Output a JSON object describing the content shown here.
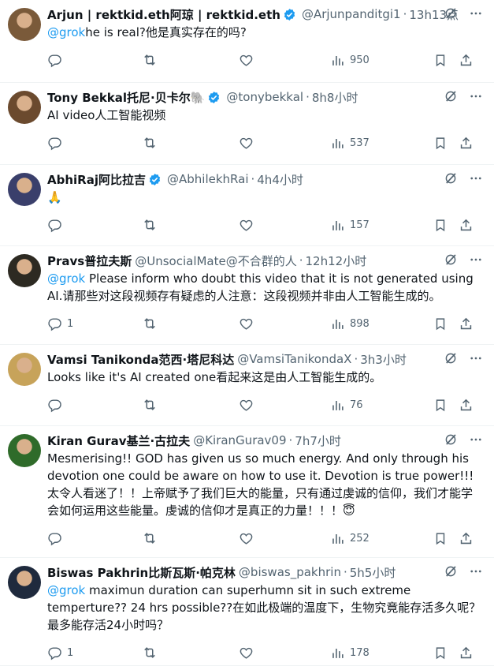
{
  "tweets": [
    {
      "name": "Arjun | rektkid.eth阿琼 | rektkid.eth",
      "verified": true,
      "handle": "@Arjunpanditgi1",
      "time": "13h13点",
      "mention": "@grok",
      "text": "he is real?他是真实存在的吗?",
      "replies": "",
      "views": "950",
      "avatar_color": "#7a5a3a"
    },
    {
      "name": "Tony Bekkal托尼·贝卡尔🐘",
      "verified": true,
      "handle": "@tonybekkal",
      "time": "8h8小时",
      "mention": "",
      "text": "AI video人工智能视频",
      "replies": "",
      "views": "537",
      "avatar_color": "#6b4a2e"
    },
    {
      "name": "AbhiRaj阿比拉吉",
      "verified": true,
      "handle": "@AbhilekhRai",
      "time": "4h4小时",
      "mention": "",
      "text": "🙏",
      "replies": "",
      "views": "157",
      "avatar_color": "#3a3f6b"
    },
    {
      "name": "Pravs普拉夫斯",
      "verified": false,
      "handle": "@UnsocialMate@不合群的人",
      "time": "12h12小时",
      "mention": "@grok",
      "text": " Please inform who doubt this video that it is not generated using AI.请那些对这段视频存有疑虑的人注意：这段视频并非由人工智能生成的。",
      "replies": "1",
      "views": "898",
      "avatar_color": "#2d2a22"
    },
    {
      "name": "Vamsi Tanikonda范西·塔尼科达",
      "verified": false,
      "handle": "@VamsiTanikondaX",
      "time": "3h3小时",
      "mention": "",
      "text": "Looks like it's AI created one看起来这是由人工智能生成的。",
      "replies": "",
      "views": "76",
      "avatar_color": "#c7a35a"
    },
    {
      "name": "Kiran Gurav基兰·古拉夫",
      "verified": false,
      "handle": "@KiranGurav09",
      "time": "7h7小时",
      "mention": "",
      "text": "Mesmerising!! GOD has given us so much energy. And only through his devotion one could be aware on how to use it. Devotion is true power!!!太令人看迷了！！上帝赋予了我们巨大的能量，只有通过虔诚的信仰，我们才能学会如何运用这些能量。虔诚的信仰才是真正的力量！！！😇",
      "replies": "",
      "views": "252",
      "avatar_color": "#2f6b2a"
    },
    {
      "name": "Biswas Pakhrin比斯瓦斯·帕克林",
      "verified": false,
      "handle": "@biswas_pakhrin",
      "time": "5h5小时",
      "mention": "@grok",
      "text": " maximun duration can superhumn sit in such extreme temperture?? 24 hrs possible??在如此极端的温度下，生物究竟能存活多久呢？最多能存活24小时吗？",
      "replies": "1",
      "views": "178",
      "avatar_color": "#1f2a3d"
    }
  ]
}
